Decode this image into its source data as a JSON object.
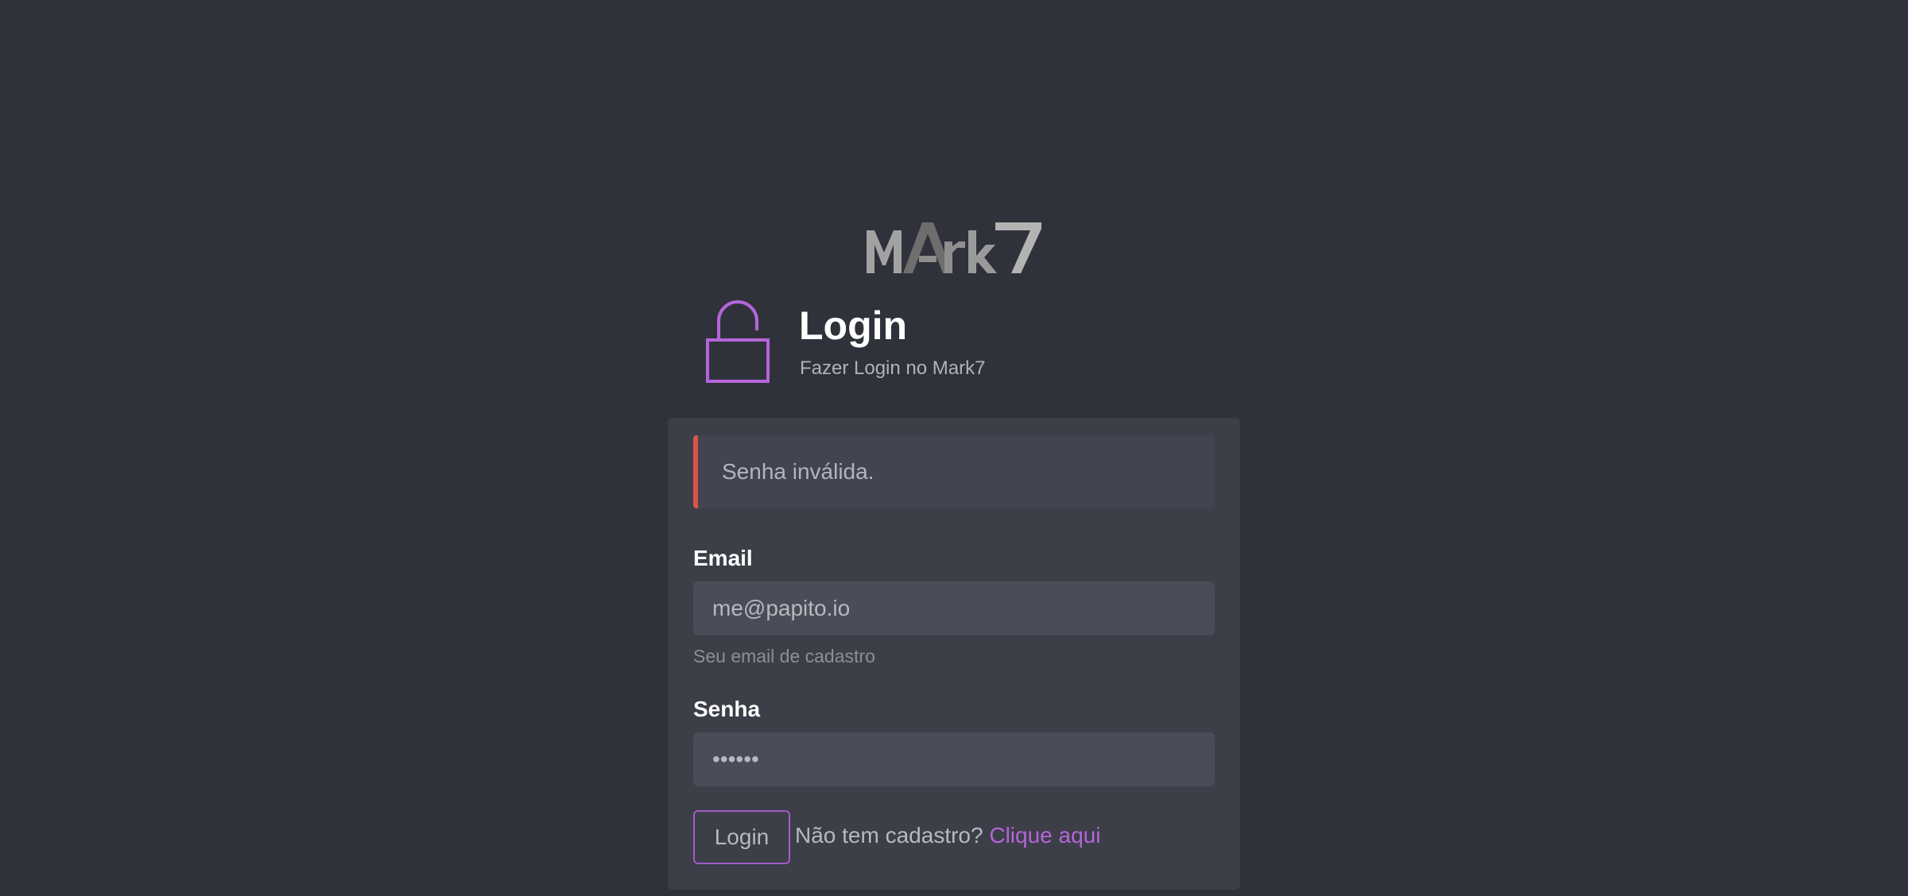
{
  "logo": {
    "text": "MArk7"
  },
  "header": {
    "title": "Login",
    "subtitle": "Fazer Login no Mark7"
  },
  "alert": {
    "message": "Senha inválida.",
    "color": "#d9534f"
  },
  "form": {
    "email": {
      "label": "Email",
      "value": "me@papito.io",
      "help": "Seu email de cadastro"
    },
    "password": {
      "label": "Senha",
      "value": "123456"
    },
    "submit_label": "Login",
    "signup_prompt": "Não tem cadastro?",
    "signup_link": "Clique aqui"
  },
  "colors": {
    "background": "#30323b",
    "card": "#3c3e48",
    "accent": "#b565d9",
    "error": "#d9534f"
  },
  "icons": {
    "lock": "unlocked-padlock-icon"
  }
}
